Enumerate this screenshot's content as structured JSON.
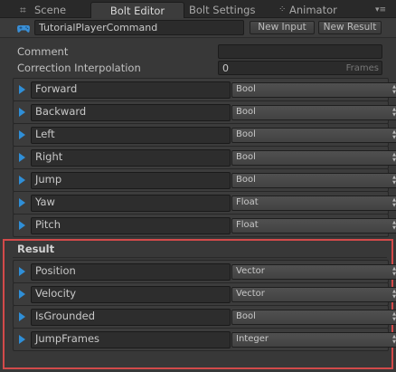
{
  "tabs": [
    {
      "label": "Scene",
      "icon": "grid-icon"
    },
    {
      "label": "Bolt Editor",
      "active": true
    },
    {
      "label": "Bolt Settings"
    },
    {
      "label": "Animator",
      "icon": "animator-icon"
    }
  ],
  "header": {
    "command_name": "TutorialPlayerCommand",
    "new_input_label": "New Input",
    "new_result_label": "New Result",
    "icon": "gamepad-icon",
    "accent_color": "#2f8fd8"
  },
  "settings": {
    "comment_label": "Comment",
    "comment_value": "",
    "correction_label": "Correction Interpolation",
    "correction_value": "0",
    "correction_unit": "Frames"
  },
  "inputs": [
    {
      "name": "Forward",
      "type": "Bool"
    },
    {
      "name": "Backward",
      "type": "Bool"
    },
    {
      "name": "Left",
      "type": "Bool"
    },
    {
      "name": "Right",
      "type": "Bool"
    },
    {
      "name": "Jump",
      "type": "Bool"
    },
    {
      "name": "Yaw",
      "type": "Float"
    },
    {
      "name": "Pitch",
      "type": "Float"
    }
  ],
  "result": {
    "title": "Result",
    "highlight_color": "#d24a4a",
    "items": [
      {
        "name": "Position",
        "type": "Vector"
      },
      {
        "name": "Velocity",
        "type": "Vector"
      },
      {
        "name": "IsGrounded",
        "type": "Bool"
      },
      {
        "name": "JumpFrames",
        "type": "Integer"
      }
    ]
  }
}
